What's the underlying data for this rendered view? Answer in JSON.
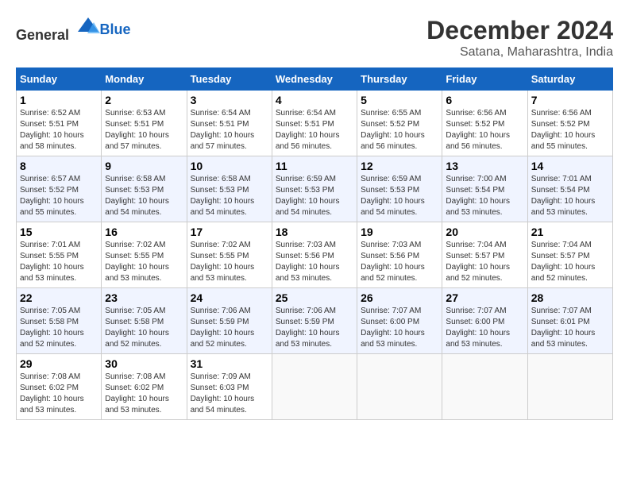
{
  "header": {
    "logo_general": "General",
    "logo_blue": "Blue",
    "title": "December 2024",
    "subtitle": "Satana, Maharashtra, India"
  },
  "calendar": {
    "days_of_week": [
      "Sunday",
      "Monday",
      "Tuesday",
      "Wednesday",
      "Thursday",
      "Friday",
      "Saturday"
    ],
    "weeks": [
      [
        {
          "day": "1",
          "detail": "Sunrise: 6:52 AM\nSunset: 5:51 PM\nDaylight: 10 hours\nand 58 minutes."
        },
        {
          "day": "2",
          "detail": "Sunrise: 6:53 AM\nSunset: 5:51 PM\nDaylight: 10 hours\nand 57 minutes."
        },
        {
          "day": "3",
          "detail": "Sunrise: 6:54 AM\nSunset: 5:51 PM\nDaylight: 10 hours\nand 57 minutes."
        },
        {
          "day": "4",
          "detail": "Sunrise: 6:54 AM\nSunset: 5:51 PM\nDaylight: 10 hours\nand 56 minutes."
        },
        {
          "day": "5",
          "detail": "Sunrise: 6:55 AM\nSunset: 5:52 PM\nDaylight: 10 hours\nand 56 minutes."
        },
        {
          "day": "6",
          "detail": "Sunrise: 6:56 AM\nSunset: 5:52 PM\nDaylight: 10 hours\nand 56 minutes."
        },
        {
          "day": "7",
          "detail": "Sunrise: 6:56 AM\nSunset: 5:52 PM\nDaylight: 10 hours\nand 55 minutes."
        }
      ],
      [
        {
          "day": "8",
          "detail": "Sunrise: 6:57 AM\nSunset: 5:52 PM\nDaylight: 10 hours\nand 55 minutes."
        },
        {
          "day": "9",
          "detail": "Sunrise: 6:58 AM\nSunset: 5:53 PM\nDaylight: 10 hours\nand 54 minutes."
        },
        {
          "day": "10",
          "detail": "Sunrise: 6:58 AM\nSunset: 5:53 PM\nDaylight: 10 hours\nand 54 minutes."
        },
        {
          "day": "11",
          "detail": "Sunrise: 6:59 AM\nSunset: 5:53 PM\nDaylight: 10 hours\nand 54 minutes."
        },
        {
          "day": "12",
          "detail": "Sunrise: 6:59 AM\nSunset: 5:53 PM\nDaylight: 10 hours\nand 54 minutes."
        },
        {
          "day": "13",
          "detail": "Sunrise: 7:00 AM\nSunset: 5:54 PM\nDaylight: 10 hours\nand 53 minutes."
        },
        {
          "day": "14",
          "detail": "Sunrise: 7:01 AM\nSunset: 5:54 PM\nDaylight: 10 hours\nand 53 minutes."
        }
      ],
      [
        {
          "day": "15",
          "detail": "Sunrise: 7:01 AM\nSunset: 5:55 PM\nDaylight: 10 hours\nand 53 minutes."
        },
        {
          "day": "16",
          "detail": "Sunrise: 7:02 AM\nSunset: 5:55 PM\nDaylight: 10 hours\nand 53 minutes."
        },
        {
          "day": "17",
          "detail": "Sunrise: 7:02 AM\nSunset: 5:55 PM\nDaylight: 10 hours\nand 53 minutes."
        },
        {
          "day": "18",
          "detail": "Sunrise: 7:03 AM\nSunset: 5:56 PM\nDaylight: 10 hours\nand 53 minutes."
        },
        {
          "day": "19",
          "detail": "Sunrise: 7:03 AM\nSunset: 5:56 PM\nDaylight: 10 hours\nand 52 minutes."
        },
        {
          "day": "20",
          "detail": "Sunrise: 7:04 AM\nSunset: 5:57 PM\nDaylight: 10 hours\nand 52 minutes."
        },
        {
          "day": "21",
          "detail": "Sunrise: 7:04 AM\nSunset: 5:57 PM\nDaylight: 10 hours\nand 52 minutes."
        }
      ],
      [
        {
          "day": "22",
          "detail": "Sunrise: 7:05 AM\nSunset: 5:58 PM\nDaylight: 10 hours\nand 52 minutes."
        },
        {
          "day": "23",
          "detail": "Sunrise: 7:05 AM\nSunset: 5:58 PM\nDaylight: 10 hours\nand 52 minutes."
        },
        {
          "day": "24",
          "detail": "Sunrise: 7:06 AM\nSunset: 5:59 PM\nDaylight: 10 hours\nand 52 minutes."
        },
        {
          "day": "25",
          "detail": "Sunrise: 7:06 AM\nSunset: 5:59 PM\nDaylight: 10 hours\nand 53 minutes."
        },
        {
          "day": "26",
          "detail": "Sunrise: 7:07 AM\nSunset: 6:00 PM\nDaylight: 10 hours\nand 53 minutes."
        },
        {
          "day": "27",
          "detail": "Sunrise: 7:07 AM\nSunset: 6:00 PM\nDaylight: 10 hours\nand 53 minutes."
        },
        {
          "day": "28",
          "detail": "Sunrise: 7:07 AM\nSunset: 6:01 PM\nDaylight: 10 hours\nand 53 minutes."
        }
      ],
      [
        {
          "day": "29",
          "detail": "Sunrise: 7:08 AM\nSunset: 6:02 PM\nDaylight: 10 hours\nand 53 minutes."
        },
        {
          "day": "30",
          "detail": "Sunrise: 7:08 AM\nSunset: 6:02 PM\nDaylight: 10 hours\nand 53 minutes."
        },
        {
          "day": "31",
          "detail": "Sunrise: 7:09 AM\nSunset: 6:03 PM\nDaylight: 10 hours\nand 54 minutes."
        },
        {
          "day": "",
          "detail": ""
        },
        {
          "day": "",
          "detail": ""
        },
        {
          "day": "",
          "detail": ""
        },
        {
          "day": "",
          "detail": ""
        }
      ]
    ]
  }
}
